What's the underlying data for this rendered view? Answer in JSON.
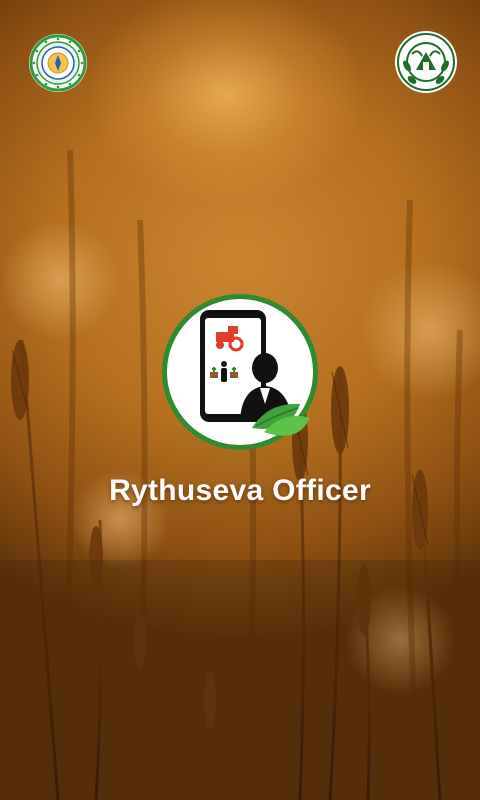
{
  "app": {
    "title": "Rythuseva Officer"
  },
  "logos": {
    "left": {
      "icon": "department-of-agriculture-seal",
      "ring_text": "DEPARTMENT OF AGRICULTURE"
    },
    "right": {
      "icon": "telugu-emblem-seal"
    }
  },
  "app_icon": {
    "icon": "farmer-mobile-icon"
  },
  "colors": {
    "background_warm": "#b4701f",
    "icon_green": "#2e8b2e",
    "leaf_green": "#3fa33a",
    "tractor_red": "#e23b2e",
    "title_text": "#ffffff"
  }
}
